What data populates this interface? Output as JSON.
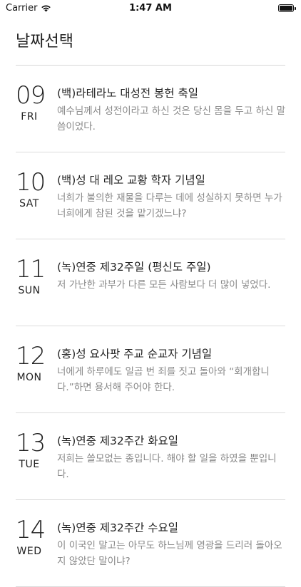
{
  "status_bar": {
    "carrier": "Carrier",
    "time": "1:47 AM"
  },
  "header": {
    "title": "날짜선택"
  },
  "days": [
    {
      "date": "09",
      "weekday": "FRI",
      "title": "(백)라테라노 대성전 봉헌 축일",
      "verse": "예수님께서 성전이라고 하신 것은 당신 몸을 두고 하신 말씀이었다."
    },
    {
      "date": "10",
      "weekday": "SAT",
      "title": "(백)성 대 레오 교황 학자 기념일",
      "verse": "너희가 불의한 재물을 다루는 데에 성실하지 못하면 누가 너희에게 참된 것을 맡기겠느냐?"
    },
    {
      "date": "11",
      "weekday": "SUN",
      "title": "(녹)연중 제32주일 (평신도 주일)",
      "verse": "저 가난한 과부가 다른 모든 사람보다 더 많이 넣었다."
    },
    {
      "date": "12",
      "weekday": "MON",
      "title": "(홍)성 요사팟 주교 순교자 기념일",
      "verse": "너에게 하루에도 일곱 번 죄를 짓고 돌아와 “회개합니다.”하면 용서해 주어야 한다."
    },
    {
      "date": "13",
      "weekday": "TUE",
      "title": "(녹)연중 제32주간 화요일",
      "verse": "저희는 쓸모없는 종입니다. 해야 할 일을 하였을 뿐입니다."
    },
    {
      "date": "14",
      "weekday": "WED",
      "title": "(녹)연중 제32주간 수요일",
      "verse": "이 이국인 말고는 아무도 하느님께 영광을 드리러 돌아오지 않았단 말이냐?"
    }
  ]
}
